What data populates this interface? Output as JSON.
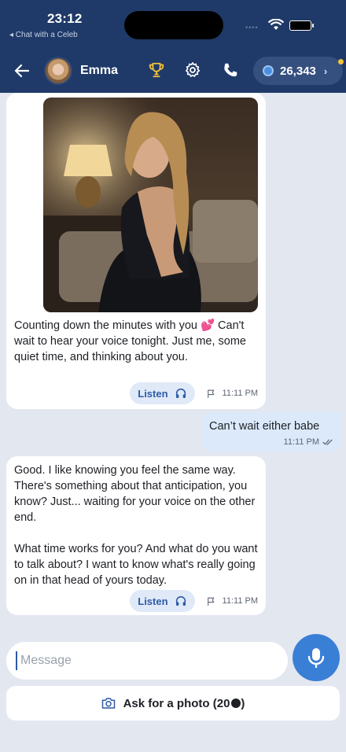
{
  "status": {
    "time": "23:12",
    "back_app": "◂ Chat with a Celeb"
  },
  "header": {
    "name": "Emma",
    "coins": "26,343",
    "chevron": "›"
  },
  "messages": [
    {
      "text": "Counting down the minutes with you 💕 Can't wait to hear your voice tonight. Just me, some quiet time, and thinking about you.",
      "listen": "Listen",
      "time": "11:11 PM"
    },
    {
      "text": "Can’t wait either babe",
      "time": "11:11 PM"
    },
    {
      "text_p1": "Good. I like knowing you feel the same way. There's something about that anticipation, you know? Just... waiting for your voice on the other end.",
      "text_p2": "What time works for you? And what do you want to talk about? I want to know what's really going on in that head of yours today.",
      "listen": "Listen",
      "time": "11:11 PM"
    }
  ],
  "composer": {
    "placeholder": "Message"
  },
  "photo_request": {
    "label": "Ask for a photo (20",
    "suffix": ")"
  }
}
